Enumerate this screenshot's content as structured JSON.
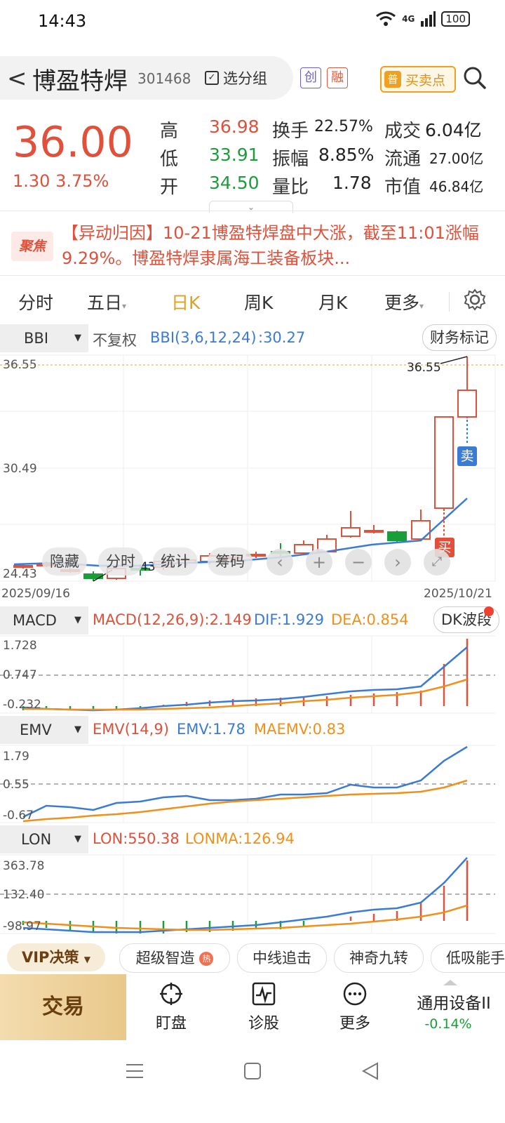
{
  "status_bar": {
    "time": "14:43",
    "network": "4G",
    "battery": "100"
  },
  "header": {
    "stock_name": "博盈特焊",
    "stock_code": "301468",
    "group_label": "选分组",
    "tag_chuang": "创",
    "tag_rong": "融",
    "bs_badge": "普",
    "bs_label": "买卖点"
  },
  "quote": {
    "price": "36.00",
    "change": "1.30 3.75%",
    "high_label": "高",
    "high": "36.98",
    "low_label": "低",
    "low": "33.91",
    "open_label": "开",
    "open": "34.50",
    "turnover_label": "换手",
    "turnover": "22.57%",
    "amplitude_label": "振幅",
    "amplitude": "8.85%",
    "vol_ratio_label": "量比",
    "vol_ratio": "1.78",
    "amount_label": "成交",
    "amount": "6.04亿",
    "float_label": "流通",
    "float_cap": "27.00亿",
    "mcap_label": "市值",
    "mcap": "46.84亿"
  },
  "news": {
    "badge": "聚焦",
    "text": "【异动归因】10-21博盈特焊盘中大涨，截至11:01涨幅9.29%。博盈特焊隶属海工装备板块..."
  },
  "tabs": [
    "分时",
    "五日",
    "日K",
    "周K",
    "月K",
    "更多"
  ],
  "tab_active": "日K",
  "kline": {
    "indicator": "BBI",
    "adjust": "不复权",
    "bbi_label": "BBI(3,6,12,24)",
    "bbi_value": ":30.27",
    "finance_btn": "财务标记",
    "y_top": "36.55",
    "y_mid": "30.49",
    "y_bottom": "24.43",
    "hi_label": "36.55",
    "lo_label": "43",
    "date_start": "2025/09/16",
    "date_end": "2025/10/21",
    "sell_mark": "卖",
    "buy_mark": "买",
    "overlay": {
      "hide": "隐藏",
      "minute": "分时",
      "stats": "统计",
      "chips": "筹码"
    }
  },
  "macd": {
    "name": "MACD",
    "params": "MACD(12,26,9):2.149",
    "dif": "DIF:1.929",
    "dea": "DEA:0.854",
    "btn": "DK波段",
    "y1": "1.728",
    "y2": "0.747",
    "y3": "-0.232"
  },
  "emv": {
    "name": "EMV",
    "params": "EMV(14,9)",
    "emv": "EMV:1.78",
    "maemv": "MAEMV:0.83",
    "y1": "1.79",
    "y2": "0.55",
    "y3": "-0.67"
  },
  "lon": {
    "name": "LON",
    "lon": "LON:550.38",
    "lonma": "LONMA:126.94",
    "y1": "363.78",
    "y2": "132.40",
    "y3": "-98.97"
  },
  "bottom_tags": {
    "vip": "VIP决策",
    "t1": "超级智造",
    "t2": "中线追击",
    "t3": "神奇九转",
    "t4": "低吸能手"
  },
  "nav": {
    "trade": "交易",
    "watch": "盯盘",
    "diagnose": "诊股",
    "more": "更多",
    "sector": "通用设备II",
    "sector_change": "-0.14%"
  },
  "colors": {
    "up": "#e0503a",
    "down": "#1a9e3a",
    "accent": "#e0a020",
    "line_blue": "#3a7bd5",
    "line_orange": "#f0901a"
  }
}
